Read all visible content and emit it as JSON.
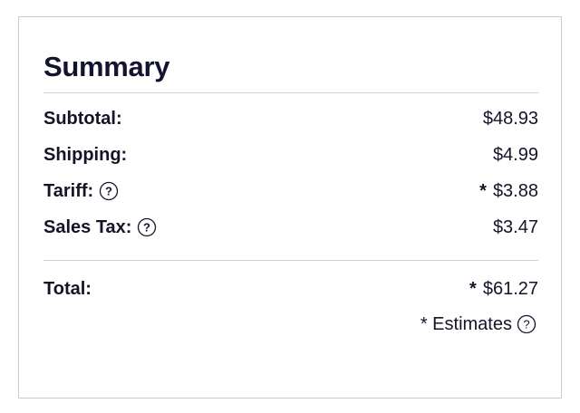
{
  "summary": {
    "title": "Summary",
    "rows": [
      {
        "label": "Subtotal:",
        "value": "$48.93"
      },
      {
        "label": "Shipping:",
        "value": "$4.99"
      },
      {
        "label": "Tariff:",
        "value": "$3.88",
        "marker": "*"
      },
      {
        "label": "Sales Tax:",
        "value": "$3.47"
      }
    ],
    "total": {
      "label": "Total:",
      "value": "$61.27",
      "marker": "*"
    },
    "estimates_note": "* Estimates"
  },
  "icons": {
    "help": "question-circle-icon"
  },
  "colors": {
    "text": "#141430",
    "border": "#c9c9cf",
    "divider": "#cfcfd4"
  }
}
